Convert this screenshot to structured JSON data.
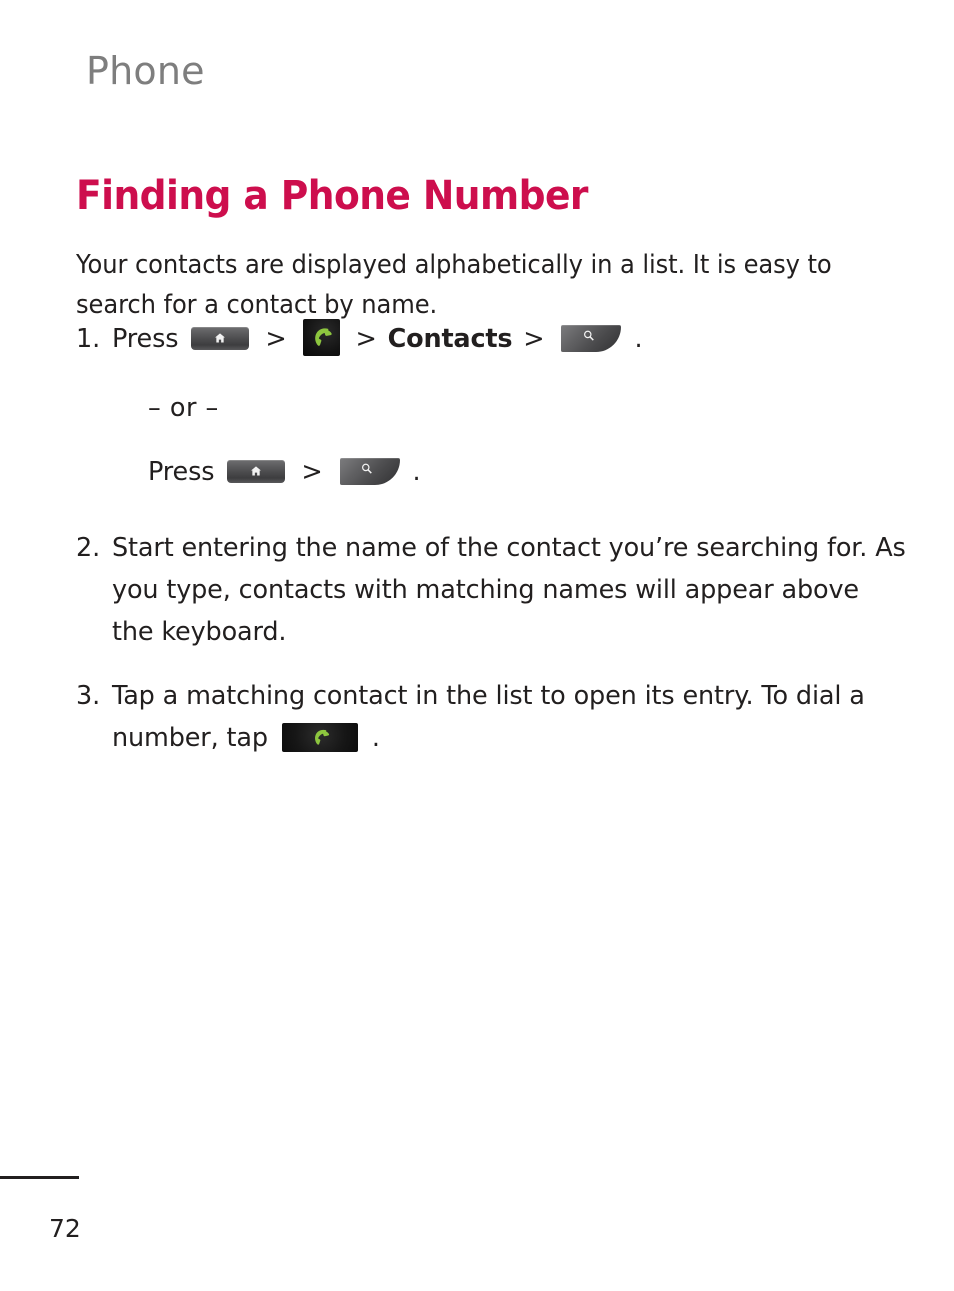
{
  "document": {
    "running_header": "Phone",
    "section_heading": "Finding a Phone Number",
    "intro_paragraph": "Your contacts are displayed alphabetically in a list. It is easy to search for a contact by name.",
    "page_number": "72"
  },
  "colors": {
    "heading_crimson": "#CD0E4D",
    "running_header_gray": "#7E7E7E",
    "body_text": "#221F1F",
    "key_dark_gray": "#4A4A4C",
    "phone_icon_green": "#8DC63F",
    "phone_icon_background": "#131313",
    "page_background": "#FFFFFF"
  },
  "steps": [
    {
      "marker": "1.",
      "lead_text": "Press",
      "icons": [
        "home-key-icon",
        "phone-app-icon",
        "search-key-icon"
      ],
      "separator": ">",
      "inline_bold_label": "Contacts",
      "trailing_period": ".",
      "alternative": {
        "or_label": "– or –",
        "lead_text": "Press",
        "separator": ">",
        "icons": [
          "home-key-icon",
          "search-key-icon"
        ],
        "trailing_period": "."
      }
    },
    {
      "marker": "2.",
      "text": "Start entering the name of the contact you’re searching for. As you type, contacts with matching names will appear above the keyboard."
    },
    {
      "marker": "3.",
      "text_before_icon": "Tap a matching contact in the list to open its entry. To dial a number, tap",
      "icon": "phone-dial-icon",
      "trailing_period": "."
    }
  ]
}
